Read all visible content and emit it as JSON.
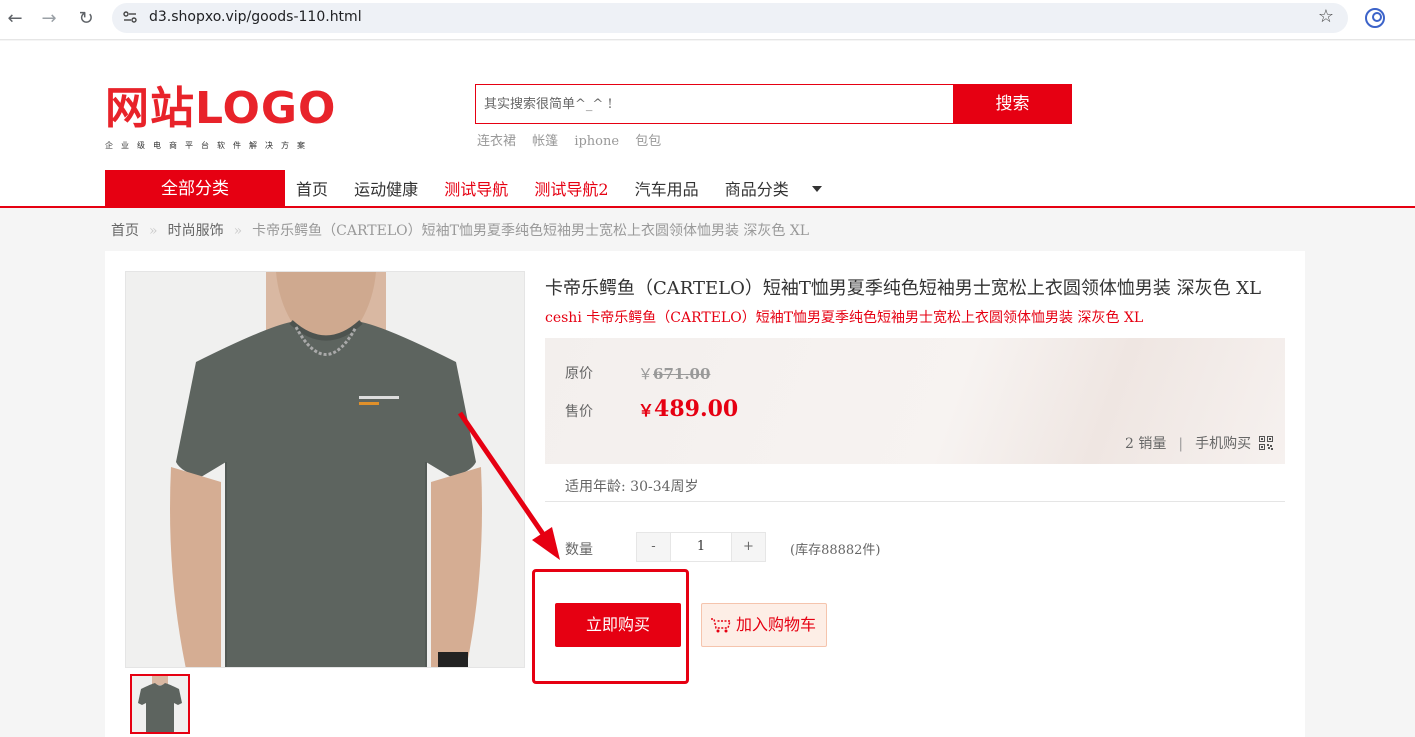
{
  "browser": {
    "url": "d3.shopxo.vip/goods-110.html",
    "back_icon": "←",
    "forward_icon": "→",
    "reload_icon": "↻",
    "bookmark_icon": "☆"
  },
  "header": {
    "logo_cn": "网站",
    "logo_en": "LOGO",
    "logo_sub": "企业级电商平台软件解决方案",
    "search_placeholder": "其实搜索很简单^_^ !",
    "search_button": "搜索",
    "hot_words": [
      "连衣裙",
      "帐篷",
      "iphone",
      "包包"
    ]
  },
  "menu": {
    "all_categories": "全部分类",
    "items": [
      {
        "label": "首页",
        "highlight": false
      },
      {
        "label": "运动健康",
        "highlight": false
      },
      {
        "label": "测试导航",
        "highlight": true
      },
      {
        "label": "测试导航2",
        "highlight": true
      },
      {
        "label": "汽车用品",
        "highlight": false
      },
      {
        "label": "商品分类",
        "highlight": false
      }
    ]
  },
  "breadcrumb": {
    "home": "首页",
    "separator": "»",
    "category": "时尚服饰",
    "current": "卡帝乐鳄鱼（CARTELO）短袖T恤男夏季纯色短袖男士宽松上衣圆领体恤男装 深灰色 XL"
  },
  "product": {
    "title": "卡帝乐鳄鱼（CARTELO）短袖T恤男夏季纯色短袖男士宽松上衣圆领体恤男装 深灰色 XL",
    "subtitle": "ceshi 卡帝乐鳄鱼（CARTELO）短袖T恤男夏季纯色短袖男士宽松上衣圆领体恤男装 深灰色 XL",
    "original_price_label": "原价",
    "currency_small": "￥",
    "original_price": "671.00",
    "sale_price_label": "售价",
    "currency": "￥",
    "sale_price": "489.00",
    "sales_count": "2",
    "sales_label": "销量",
    "stats_separator": "|",
    "mobile_buy": "手机购买",
    "param": "适用年龄: 30-34周岁",
    "quantity_label": "数量",
    "quantity_minus": "-",
    "quantity": "1",
    "quantity_plus": "+",
    "stock": "(库存88882件)",
    "buy_now": "立即购买",
    "add_to_cart": "加入购物车",
    "shirt_print": "OPSPIMEN summer"
  },
  "colors": {
    "brand_red": "#e60012",
    "shirt_gray": "#5d645f"
  }
}
